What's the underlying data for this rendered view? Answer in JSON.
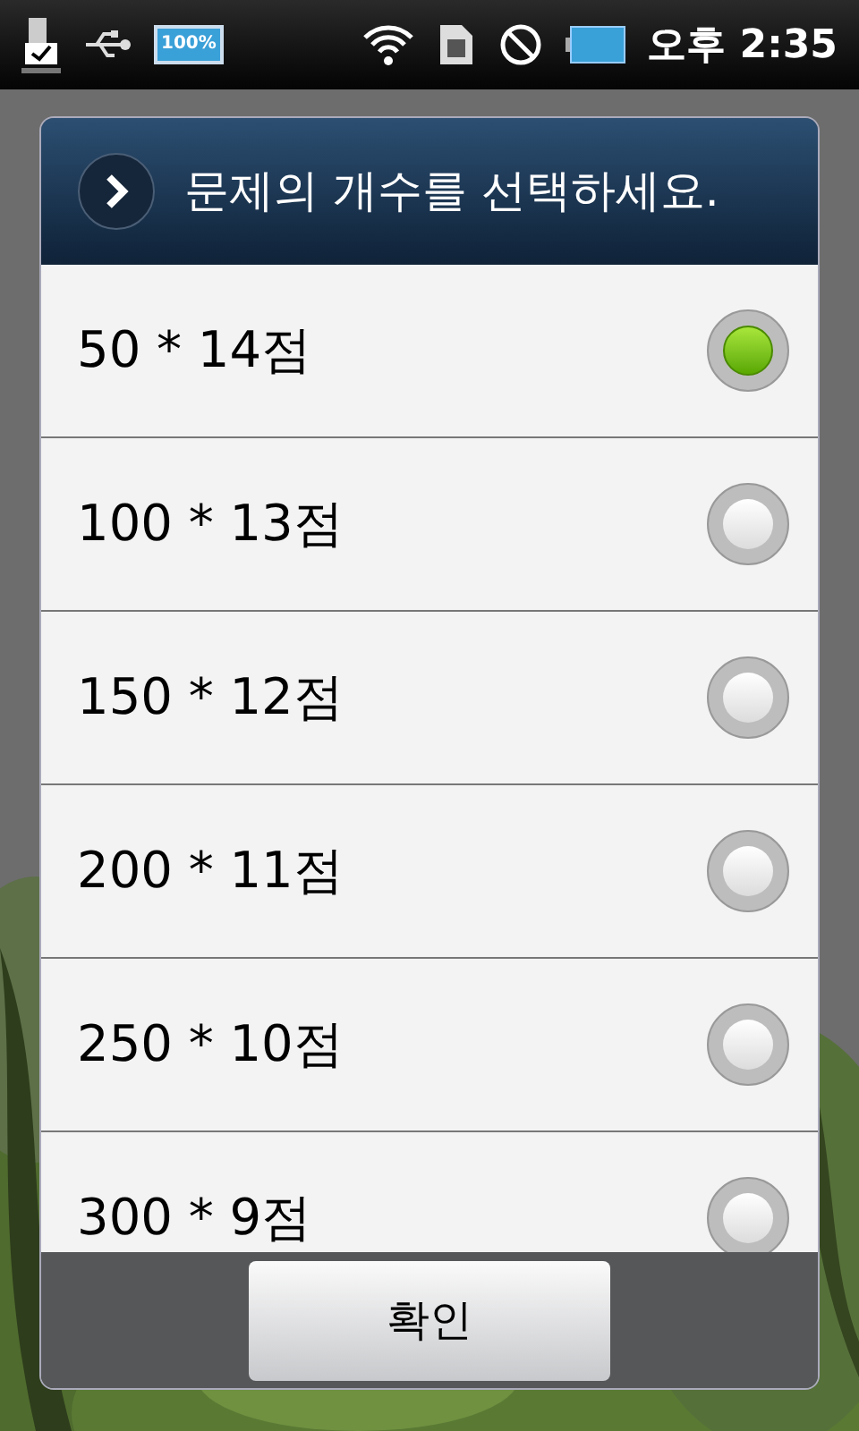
{
  "status_bar": {
    "battery_label": "100%",
    "time": "오후 2:35"
  },
  "dialog": {
    "title": "문제의 개수를 선택하세요.",
    "options": [
      {
        "label": "50 * 14점",
        "selected": true
      },
      {
        "label": "100 * 13점",
        "selected": false
      },
      {
        "label": "150 * 12점",
        "selected": false
      },
      {
        "label": "200 * 11점",
        "selected": false
      },
      {
        "label": "250 * 10점",
        "selected": false
      },
      {
        "label": "300 * 9점",
        "selected": false
      }
    ],
    "button": "확인"
  }
}
